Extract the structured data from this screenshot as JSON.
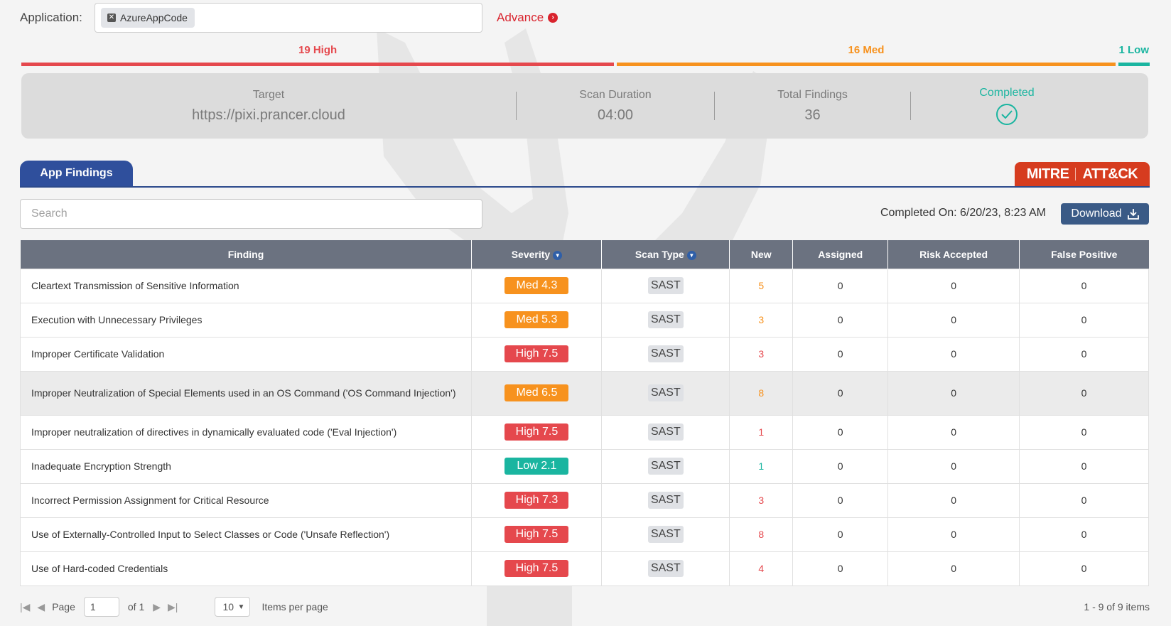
{
  "application": {
    "label": "Application:",
    "chip": "AzureAppCode",
    "advance": "Advance"
  },
  "severity_summary": {
    "high_label": "19 High",
    "med_label": "16 Med",
    "low_label": "1 Low",
    "high_count": 19,
    "med_count": 16,
    "low_count": 1,
    "colors": {
      "high": "#e5484d",
      "med": "#f7921e",
      "low": "#1ab5a0"
    }
  },
  "summary": {
    "target_label": "Target",
    "target_value": "https://pixi.prancer.cloud",
    "duration_label": "Scan Duration",
    "duration_value": "04:00",
    "total_label": "Total Findings",
    "total_value": "36",
    "status_label": "Completed",
    "status_icon": "check-circle-icon"
  },
  "tabs": {
    "app_findings": "App Findings",
    "mitre_left": "MITRE",
    "mitre_right": "ATT&CK"
  },
  "search": {
    "placeholder": "Search",
    "value": ""
  },
  "completed_on": "Completed On: 6/20/23, 8:23 AM",
  "download_label": "Download",
  "table": {
    "headers": {
      "finding": "Finding",
      "severity": "Severity",
      "scan_type": "Scan Type",
      "new": "New",
      "assigned": "Assigned",
      "risk_accepted": "Risk Accepted",
      "false_positive": "False Positive"
    },
    "rows": [
      {
        "finding": "Cleartext Transmission of Sensitive Information",
        "severity": "Med 4.3",
        "level": "med",
        "scan_type": "SAST",
        "new": "5",
        "assigned": "0",
        "risk_accepted": "0",
        "false_positive": "0"
      },
      {
        "finding": "Execution with Unnecessary Privileges",
        "severity": "Med 5.3",
        "level": "med",
        "scan_type": "SAST",
        "new": "3",
        "assigned": "0",
        "risk_accepted": "0",
        "false_positive": "0"
      },
      {
        "finding": "Improper Certificate Validation",
        "severity": "High 7.5",
        "level": "high",
        "scan_type": "SAST",
        "new": "3",
        "assigned": "0",
        "risk_accepted": "0",
        "false_positive": "0"
      },
      {
        "finding": "Improper Neutralization of Special Elements used in an OS Command ('OS Command Injection')",
        "severity": "Med 6.5",
        "level": "med",
        "scan_type": "SAST",
        "new": "8",
        "assigned": "0",
        "risk_accepted": "0",
        "false_positive": "0"
      },
      {
        "finding": "Improper neutralization of directives in dynamically evaluated code ('Eval Injection')",
        "severity": "High 7.5",
        "level": "high",
        "scan_type": "SAST",
        "new": "1",
        "assigned": "0",
        "risk_accepted": "0",
        "false_positive": "0"
      },
      {
        "finding": "Inadequate Encryption Strength",
        "severity": "Low 2.1",
        "level": "low",
        "scan_type": "SAST",
        "new": "1",
        "assigned": "0",
        "risk_accepted": "0",
        "false_positive": "0"
      },
      {
        "finding": "Incorrect Permission Assignment for Critical Resource",
        "severity": "High 7.3",
        "level": "high",
        "scan_type": "SAST",
        "new": "3",
        "assigned": "0",
        "risk_accepted": "0",
        "false_positive": "0"
      },
      {
        "finding": "Use of Externally-Controlled Input to Select Classes or Code ('Unsafe Reflection')",
        "severity": "High 7.5",
        "level": "high",
        "scan_type": "SAST",
        "new": "8",
        "assigned": "0",
        "risk_accepted": "0",
        "false_positive": "0"
      },
      {
        "finding": "Use of Hard-coded Credentials",
        "severity": "High 7.5",
        "level": "high",
        "scan_type": "SAST",
        "new": "4",
        "assigned": "0",
        "risk_accepted": "0",
        "false_positive": "0"
      }
    ]
  },
  "pager": {
    "page_label": "Page",
    "page_value": "1",
    "of_label": "of 1",
    "per_page": "10",
    "per_page_label": "Items per page",
    "count": "1 - 9 of 9 items"
  }
}
